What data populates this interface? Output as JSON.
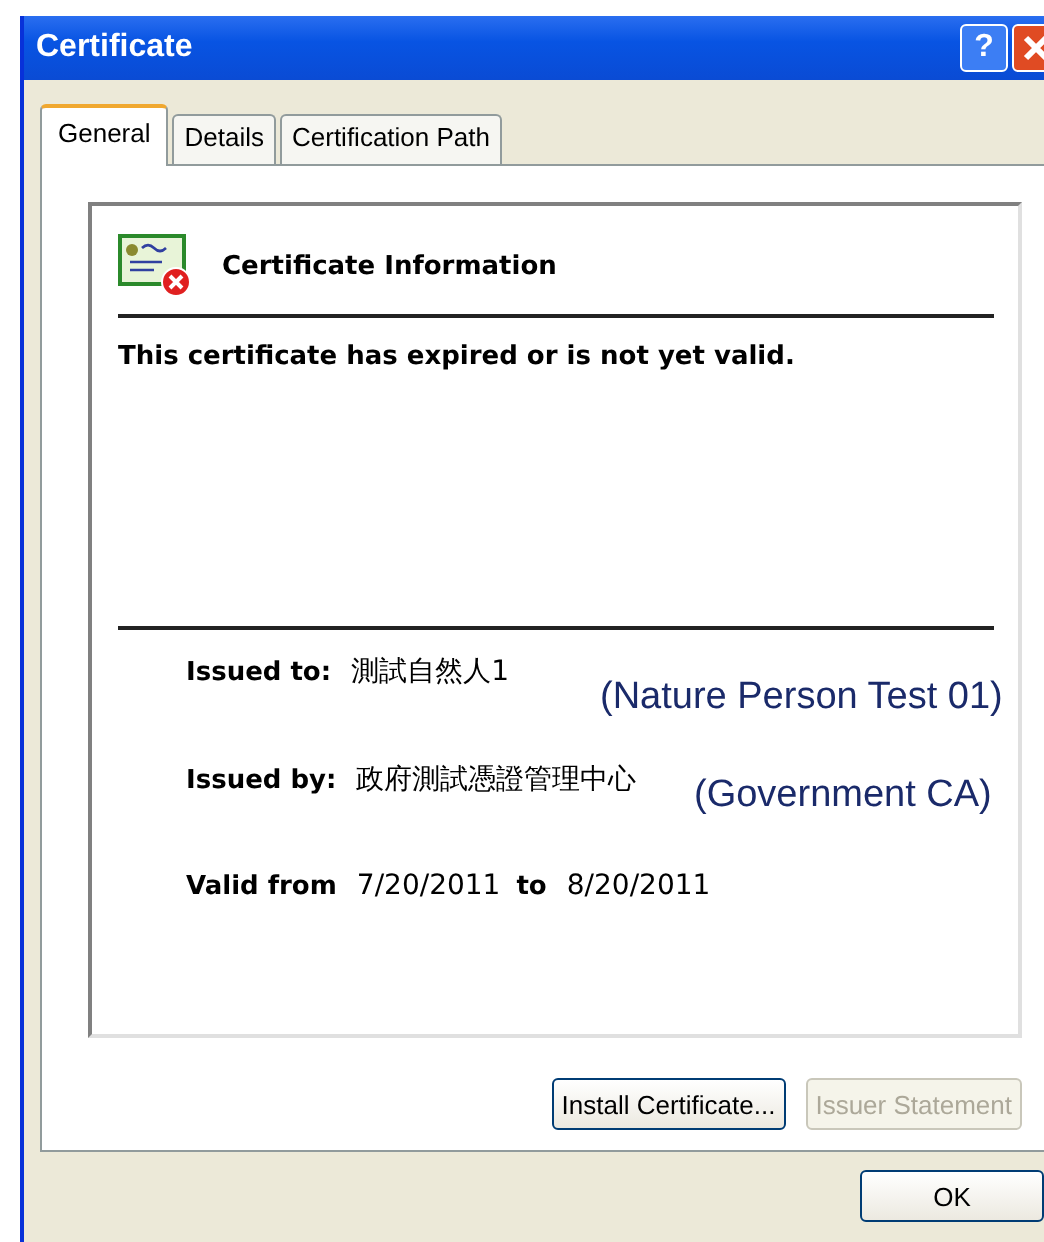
{
  "window": {
    "title": "Certificate",
    "help": "?"
  },
  "tabs": [
    {
      "label": "General",
      "selected": true
    },
    {
      "label": "Details",
      "selected": false
    },
    {
      "label": "Certification Path",
      "selected": false
    }
  ],
  "info": {
    "heading": "Certificate Information",
    "status": "This certificate has expired or is not yet valid."
  },
  "fields": [
    {
      "label": "Issued to:",
      "value": "測試自然人1"
    },
    {
      "label": "Issued by:",
      "value": "政府測試憑證管理中心"
    }
  ],
  "validity": {
    "from_label": "Valid from",
    "from": "7/20/2011",
    "to_label": "to",
    "to": "8/20/2011"
  },
  "panel_buttons": [
    {
      "label": "Install Certificate...",
      "disabled": false
    },
    {
      "label": "Issuer Statement",
      "disabled": true
    }
  ],
  "ok_button": "OK",
  "annotations": [
    "(Nature Person Test 01)",
    "(Government CA)"
  ]
}
